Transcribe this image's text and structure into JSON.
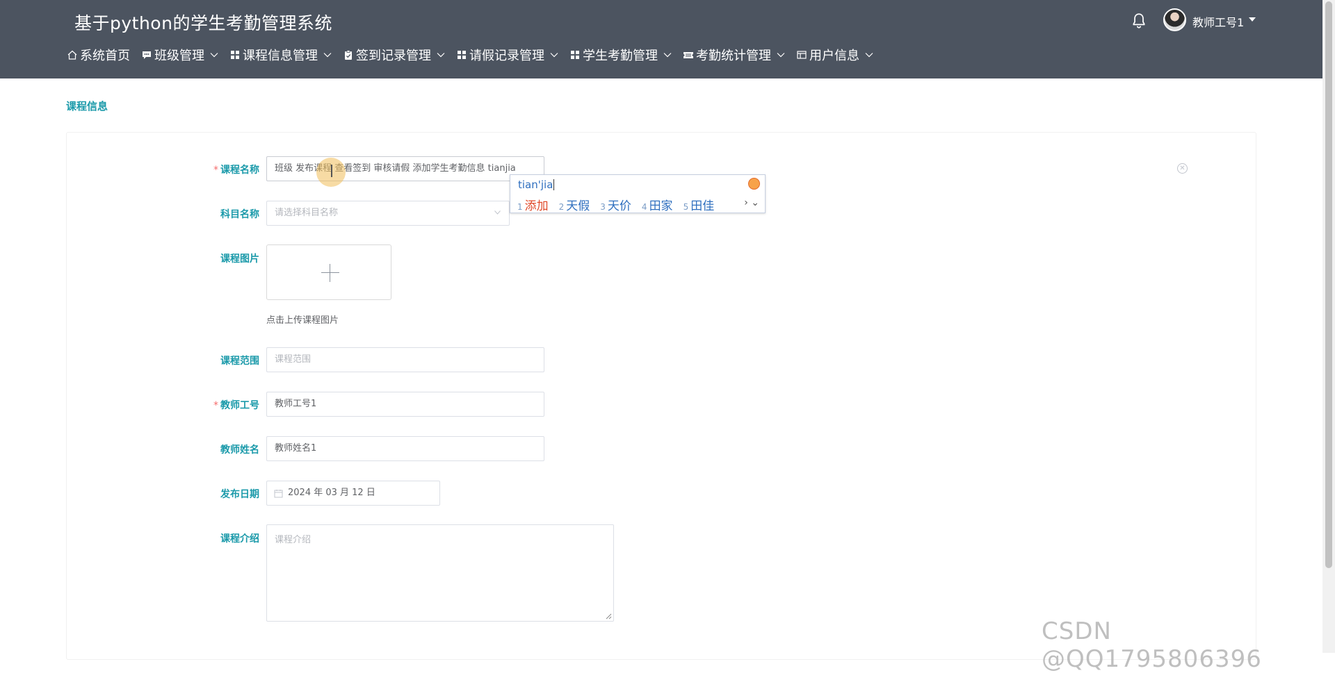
{
  "app": {
    "title": "基于python的学生考勤管理系统"
  },
  "user": {
    "name": "教师工号1"
  },
  "nav": {
    "items": [
      {
        "label": "系统首页",
        "icon": "home-icon",
        "has_dropdown": false
      },
      {
        "label": "班级管理",
        "icon": "chat-icon",
        "has_dropdown": true
      },
      {
        "label": "课程信息管理",
        "icon": "grid-icon",
        "has_dropdown": true
      },
      {
        "label": "签到记录管理",
        "icon": "clipboard-icon",
        "has_dropdown": true
      },
      {
        "label": "请假记录管理",
        "icon": "grid-icon",
        "has_dropdown": true
      },
      {
        "label": "学生考勤管理",
        "icon": "grid-icon",
        "has_dropdown": true
      },
      {
        "label": "考勤统计管理",
        "icon": "ticket-icon",
        "has_dropdown": true
      },
      {
        "label": "用户信息",
        "icon": "window-icon",
        "has_dropdown": true
      }
    ]
  },
  "breadcrumb": {
    "title": "课程信息"
  },
  "form": {
    "course_name": {
      "label": "课程名称",
      "required": true,
      "value": "班级 发布课程 查看签到 审核请假 添加学生考勤信息  tianjia"
    },
    "subject_name": {
      "label": "科目名称",
      "required": false,
      "placeholder": "请选择科目名称"
    },
    "course_image": {
      "label": "课程图片",
      "hint": "点击上传课程图片"
    },
    "course_scope": {
      "label": "课程范围",
      "required": false,
      "placeholder": "课程范围"
    },
    "teacher_id": {
      "label": "教师工号",
      "required": true,
      "value": "教师工号1"
    },
    "teacher_name": {
      "label": "教师姓名",
      "required": false,
      "value": "教师姓名1"
    },
    "publish_date": {
      "label": "发布日期",
      "required": false,
      "value": "2024 年 03 月 12 日"
    },
    "course_intro": {
      "label": "课程介绍",
      "required": false,
      "placeholder": "课程介绍"
    }
  },
  "ime": {
    "pinyin": "tian'jia",
    "candidates": [
      {
        "num": "1",
        "word": "添加"
      },
      {
        "num": "2",
        "word": "天假"
      },
      {
        "num": "3",
        "word": "天价"
      },
      {
        "num": "4",
        "word": "田家"
      },
      {
        "num": "5",
        "word": "田佳"
      }
    ],
    "nav_symbol": "›"
  },
  "watermark": "CSDN @QQ1795806396",
  "colors": {
    "header_bg": "#4c5460",
    "accent": "#1b9aaa",
    "required": "#f56c6c",
    "ime_first": "#e04a2a"
  }
}
